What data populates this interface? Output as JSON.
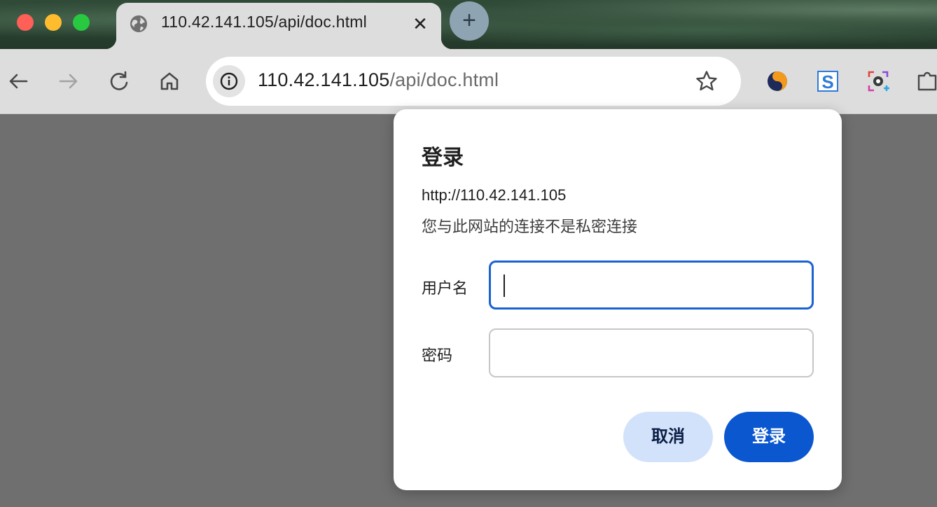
{
  "browser": {
    "tab": {
      "title": "110.42.141.105/api/doc.html",
      "close_glyph": "✕",
      "favicon": "globe-icon"
    },
    "new_tab_glyph": "+",
    "omnibox": {
      "url_host": "110.42.141.105",
      "url_path": "/api/doc.html",
      "site_info_icon": "info-icon",
      "bookmark_icon": "star-icon"
    },
    "nav_icons": [
      "back-arrow-icon",
      "forward-arrow-icon",
      "reload-icon",
      "home-icon"
    ],
    "extensions": [
      "extension-swirl-icon",
      "extension-s-icon",
      "extension-camera-icon",
      "extension-puzzle-icon"
    ]
  },
  "dialog": {
    "title": "登录",
    "origin": "http://110.42.141.105",
    "warning": "您与此网站的连接不是私密连接",
    "username_label": "用户名",
    "username_value": "",
    "password_label": "密码",
    "password_value": "",
    "cancel_label": "取消",
    "login_label": "登录"
  },
  "colors": {
    "primary_button": "#0b57d0",
    "secondary_button": "#d3e2fb",
    "focus_border": "#1a62d1",
    "page_overlay": "#6f6f6f"
  }
}
